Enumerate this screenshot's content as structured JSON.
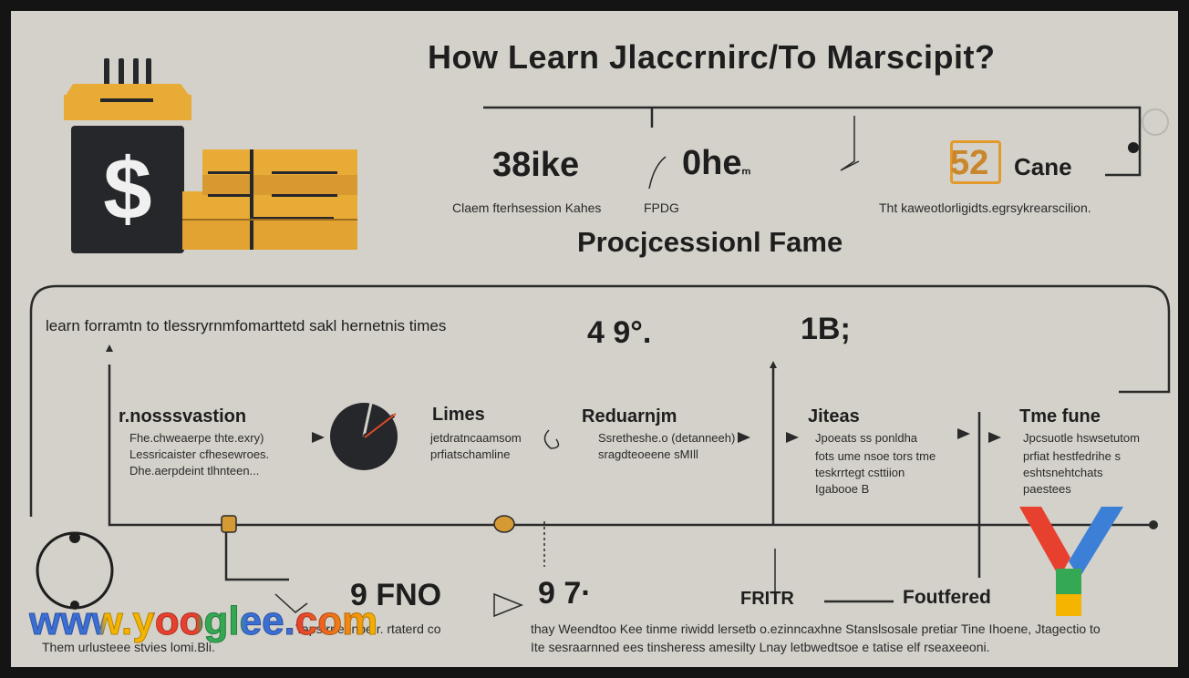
{
  "title": "How Learn Jlaccrnirc/To Marscipit?",
  "subtitle": "Procjcessionl Fame",
  "top_stats": [
    {
      "value": "38ike",
      "caption": "Claem fterhsession Kahes"
    },
    {
      "value": "0he",
      "suffix": "ₘ",
      "caption": "FPDG"
    },
    {
      "badge": "52",
      "value": "Cane",
      "caption": "Tht kaweotlorligidts.egrsykrearscilion."
    }
  ],
  "intro_text": "learn forramtn to tlessryrnmfomarttetd sakl hernetnis times",
  "mid_stats": [
    "4 9°.",
    "1B;"
  ],
  "steps": [
    {
      "title": "r.nosssvastion",
      "lines": [
        "Fhe.chweaerpe thte.exry)",
        "Lessricaister cfhesewroes.",
        "Dhe.aerpdeint tlhnteen..."
      ]
    },
    {
      "title": "Limes",
      "lines": [
        "jetdratncaamsom",
        "prfiatschamline"
      ]
    },
    {
      "title": "Reduarnjm",
      "lines": [
        "Ssretheshe.o (detanneeh)",
        "sragdteoeene sMIll"
      ]
    },
    {
      "title": "Jiteas",
      "lines": [
        "Jpoeats ss ponldha",
        "fots ume nsoe tors tme",
        "teskrrtegt csttiion",
        "Igabooe B"
      ]
    },
    {
      "title": "Tme fune",
      "lines": [
        "Jpcsuotle hswsetutom",
        "prfiat hestfedrihe s",
        "eshtsnehtchats",
        "paestees"
      ]
    }
  ],
  "bottom_stats": [
    "9 FNO",
    "9 7·"
  ],
  "bottom_labels": [
    "FRITR",
    "Foutfered"
  ],
  "bottom_left_text": [
    "Tapstrneenbe.r. rtaterd co",
    "Them urlusteee stvies lomi.Bli."
  ],
  "bottom_right_text": [
    "thay Weendtoo Kee tinme riwidd lersetb o.ezinncaxhne Stanslsosale pretiar Tine Ihoene, Jtagectio to",
    "Ite sesraarnned ees tinsheress amesilty Lnay letbwedtsoe e tatise elf rseaxeeoni."
  ],
  "watermark": "www.yooglee.com",
  "colors": {
    "background": "#d3d1c9",
    "frame": "#141414",
    "ink": "#1e1e1e",
    "gold": "#e8ab36",
    "gold_dark": "#c98f2a",
    "dark": "#2a2b30",
    "accent_orange": "#e39a2c"
  }
}
